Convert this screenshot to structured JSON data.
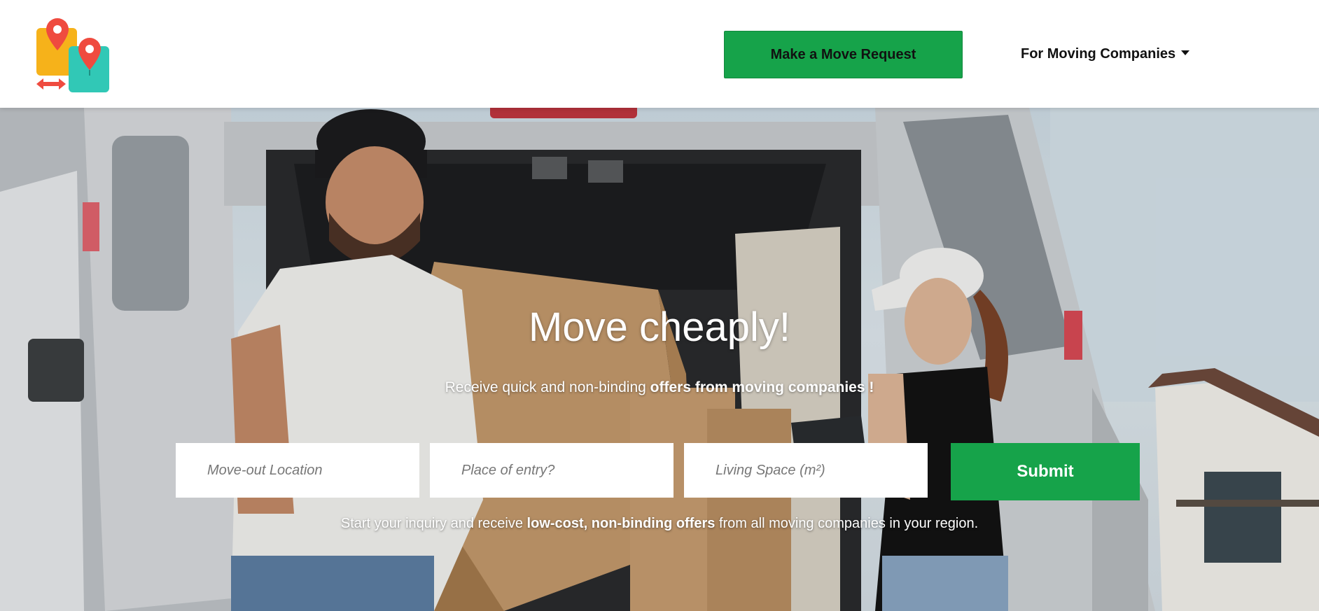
{
  "header": {
    "logo_icon": "moving-locations-logo",
    "request_button": "Make a Move Request",
    "companies_menu": "For Moving Companies",
    "companies_menu_icon": "caret-down-icon",
    "accent_color": "#16a34a"
  },
  "hero": {
    "background": "photo of two movers loading cardboard boxes into a van",
    "title": "Move cheaply!",
    "subtitle_prefix": "Receive quick and non-binding ",
    "subtitle_bold": "offers from moving companies !",
    "form": {
      "move_out_placeholder": "Move-out Location",
      "entry_placeholder": "Place of entry?",
      "living_space_placeholder": "Living Space (m²)",
      "submit_label": "Submit"
    },
    "footer_prefix": "Start your inquiry and receive ",
    "footer_bold": "low-cost, non-binding offers",
    "footer_suffix": " from all moving companies in your region."
  }
}
